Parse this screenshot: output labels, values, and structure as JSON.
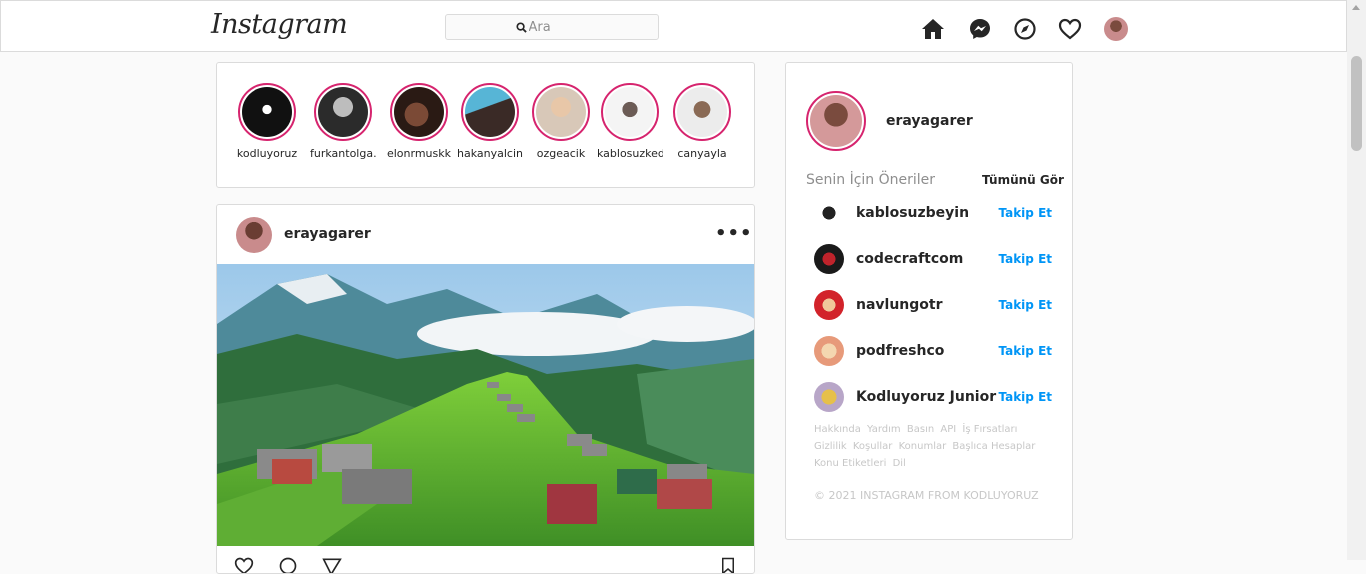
{
  "header": {
    "logo": "Instagram",
    "search_placeholder": "Ara",
    "icons": [
      "home-icon",
      "messenger-icon",
      "explore-icon",
      "heart-icon",
      "profile-avatar"
    ]
  },
  "stories": [
    {
      "name": "kodluyoruz"
    },
    {
      "name": "furkantolga.."
    },
    {
      "name": "elonrmuskk"
    },
    {
      "name": "hakanyalcin.."
    },
    {
      "name": "ozgeacik"
    },
    {
      "name": "kablosuzkedi"
    },
    {
      "name": "canyayla"
    }
  ],
  "post": {
    "username": "erayagarer",
    "more": "•••"
  },
  "sidebar": {
    "username": "erayagarer",
    "suggestions_title": "Senin İçin Öneriler",
    "see_all": "Tümünü Gör",
    "suggestions": [
      {
        "name": "kablosuzbeyin",
        "action": "Takip Et"
      },
      {
        "name": "codecraftcom",
        "action": "Takip Et"
      },
      {
        "name": "navlungotr",
        "action": "Takip Et"
      },
      {
        "name": "podfreshco",
        "action": "Takip Et"
      },
      {
        "name": "Kodluyoruz Junior",
        "action": "Takip Et"
      }
    ],
    "footer_links": [
      "Hakkında",
      "Yardım",
      "Basın",
      "API",
      "İş Fırsatları",
      "Gizlilik",
      "Koşullar",
      "Konumlar",
      "Başlıca Hesaplar",
      "Konu Etiketleri",
      "Dil"
    ],
    "copyright": "© 2021 INSTAGRAM FROM KODLUYORUZ"
  },
  "colors": {
    "accent_blue": "#0095f6",
    "story_ring": "#d6246e",
    "border": "#dbdbdb",
    "background": "#fafafa"
  }
}
